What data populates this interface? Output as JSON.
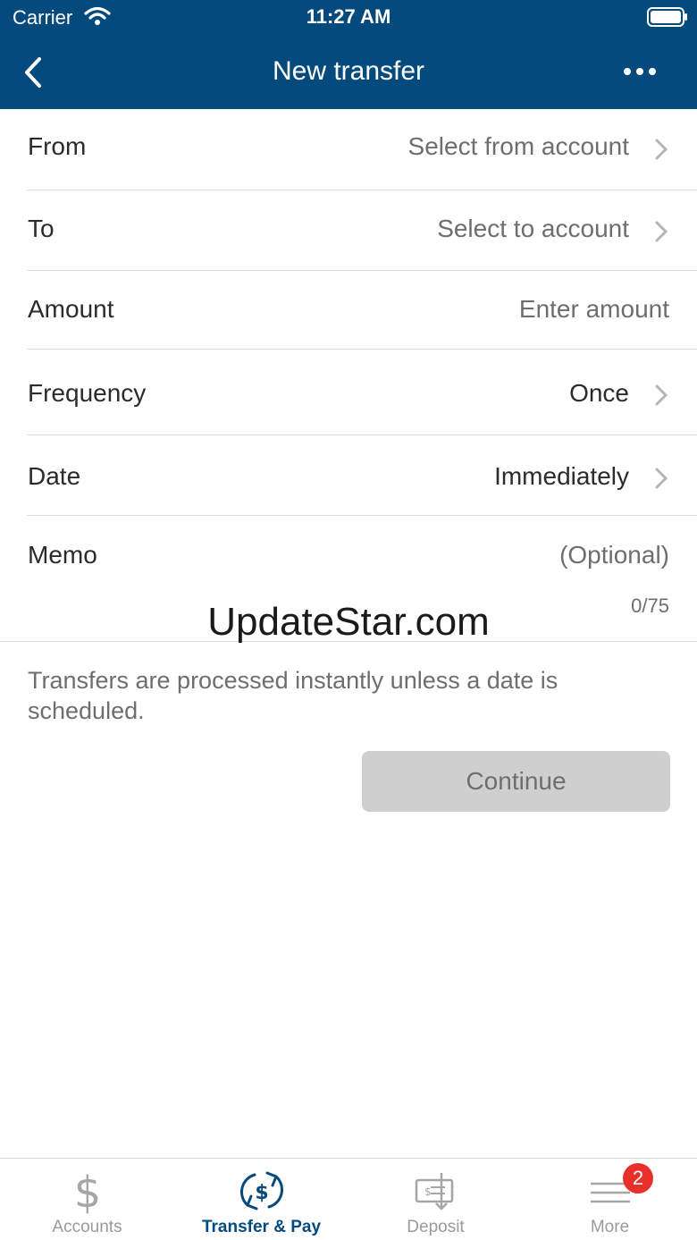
{
  "status_bar": {
    "carrier": "Carrier",
    "time": "11:27 AM",
    "wifi_icon": "wifi-icon",
    "battery_icon": "battery-icon"
  },
  "nav": {
    "title": "New transfer",
    "back_icon": "chevron-left-icon",
    "more_icon": "ellipsis-icon"
  },
  "form": {
    "rows": [
      {
        "label": "From",
        "value": "Select from account"
      },
      {
        "label": "To",
        "value": "Select to account"
      },
      {
        "label": "Amount",
        "value": "Enter amount"
      },
      {
        "label": "Frequency",
        "value": "Once"
      },
      {
        "label": "Date",
        "value": "Immediately"
      },
      {
        "label": "Memo",
        "value": "(Optional)"
      }
    ],
    "memo_counter": "0/75"
  },
  "watermark": "UpdateStar.com",
  "info_text": "Transfers are processed instantly unless a date is scheduled.",
  "continue_label": "Continue",
  "tabs": [
    {
      "label": "Accounts",
      "icon": "dollar-icon"
    },
    {
      "label": "Transfer & Pay",
      "icon": "transfer-dollar-icon"
    },
    {
      "label": "Deposit",
      "icon": "check-deposit-icon"
    },
    {
      "label": "More",
      "icon": "menu-icon"
    }
  ],
  "more_badge": "2",
  "colors": {
    "header": "#044a7d",
    "active_tab": "#044a7d",
    "badge": "#e8302a",
    "button_disabled": "#cfcfcf"
  }
}
